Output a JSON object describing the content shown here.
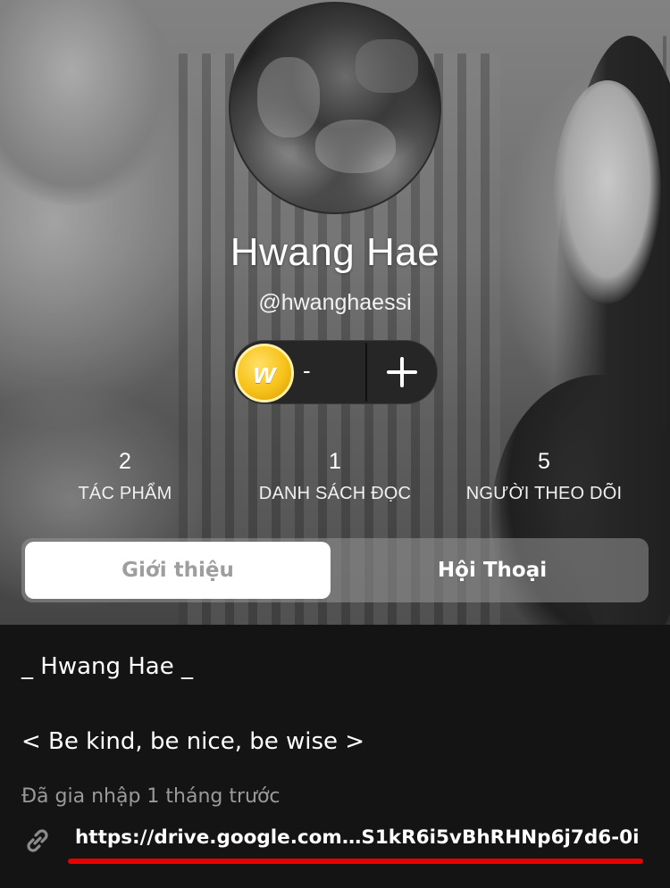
{
  "profile": {
    "display_name": "Hwang Hae",
    "username": "@hwanghaessi"
  },
  "coins": {
    "icon": "wattpad-coin-icon",
    "icon_letter": "w",
    "count": "-",
    "add_icon": "plus-icon"
  },
  "stats": [
    {
      "value": "2",
      "label": "TÁC PHẨM"
    },
    {
      "value": "1",
      "label": "DANH SÁCH ĐỌC"
    },
    {
      "value": "5",
      "label": "NGƯỜI THEO DÕI"
    }
  ],
  "tabs": {
    "about": "Giới thiệu",
    "conversations": "Hội Thoại",
    "active": "about"
  },
  "bio": {
    "line1": "_ Hwang Hae _",
    "line2": "< Be kind, be nice, be wise >",
    "joined": "Đã gia nhập 1 tháng trước",
    "link_icon": "link-icon",
    "link": "https://drive.google.com…S1kR6i5vBhRHNp6j7d6-0i"
  },
  "colors": {
    "background": "#141414",
    "tab_active_bg": "#ffffff",
    "tab_active_text": "#9e9e9e",
    "coin": "#f7c21a",
    "underline_mark": "#e60000",
    "muted_text": "#9a9a9a"
  }
}
